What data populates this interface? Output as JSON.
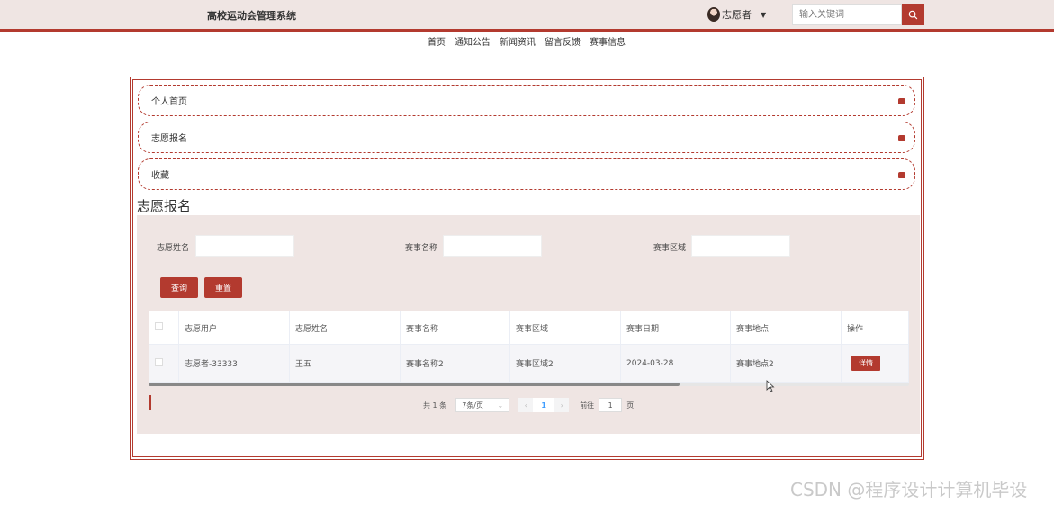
{
  "header": {
    "site_title": "高校运动会管理系统",
    "user_name": "志愿者",
    "search_placeholder": "输入关键词"
  },
  "nav": [
    "首页",
    "通知公告",
    "新闻资讯",
    "留言反馈",
    "赛事信息"
  ],
  "menu": [
    "个人首页",
    "志愿报名",
    "收藏"
  ],
  "section_title": "志愿报名",
  "filters": {
    "volunteer_name_label": "志愿姓名",
    "event_name_label": "赛事名称",
    "event_area_label": "赛事区域"
  },
  "buttons": {
    "query": "查询",
    "reset": "重置"
  },
  "table": {
    "headers": [
      "志愿用户",
      "志愿姓名",
      "赛事名称",
      "赛事区域",
      "赛事日期",
      "赛事地点",
      "操作"
    ],
    "rows": [
      {
        "user": "志愿者-33333",
        "name": "王五",
        "event": "赛事名称2",
        "area": "赛事区域2",
        "date": "2024-03-28",
        "place": "赛事地点2",
        "action": "详情"
      }
    ]
  },
  "pagination": {
    "total": "共 1 条",
    "page_size": "7条/页",
    "current": "1",
    "goto_label": "前往",
    "goto_value": "1",
    "page_suffix": "页"
  },
  "watermark": "CSDN @程序设计计算机毕设",
  "colors": {
    "accent": "#b33a2f",
    "header_bg": "#efe5e3"
  }
}
